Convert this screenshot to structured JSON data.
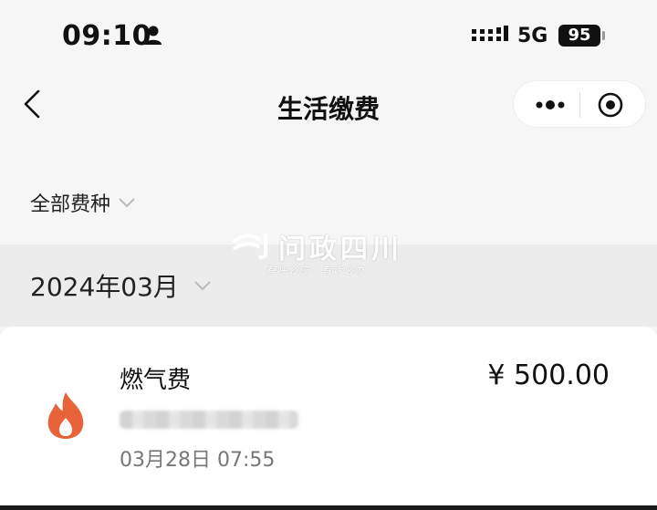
{
  "status_bar": {
    "time": "09:10",
    "network": "5G",
    "battery": "95"
  },
  "navbar": {
    "title": "生活缴费"
  },
  "filter": {
    "label": "全部费种"
  },
  "month": {
    "label": "2024年03月"
  },
  "watermark": {
    "text": "问政四川",
    "sub": "有呼必应 · 有诉必办"
  },
  "payment": {
    "name": "燃气费",
    "amount": "¥ 500.00",
    "datetime": "03月28日 07:55",
    "icon": "flame-icon",
    "icon_color": "#e8623a"
  }
}
